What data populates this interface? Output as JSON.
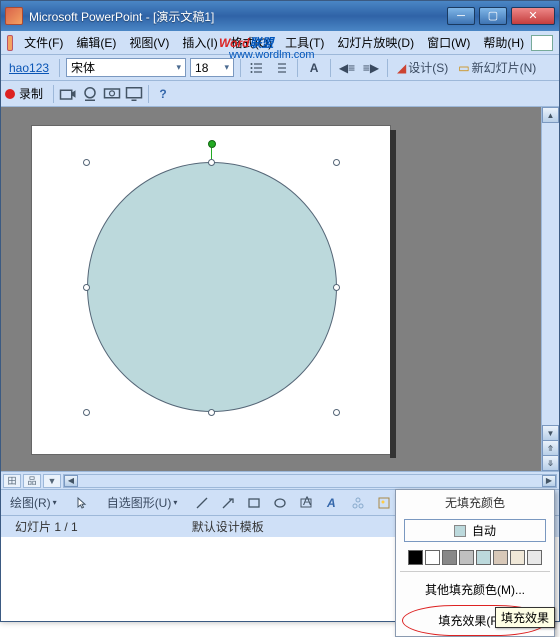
{
  "titlebar": {
    "title": "Microsoft PowerPoint - [演示文稿1]"
  },
  "menu": {
    "file": "文件(F)",
    "edit": "编辑(E)",
    "view": "视图(V)",
    "insert": "插入(I)",
    "format": "格式(O)",
    "tools": "工具(T)",
    "slideshow": "幻灯片放映(D)",
    "window": "窗口(W)",
    "help": "帮助(H)"
  },
  "toolbar1": {
    "hao": "hao123",
    "font": "宋体",
    "size": "18",
    "design": "设计(S)",
    "newslide": "新幻灯片(N)"
  },
  "toolbar2": {
    "rec": "录制"
  },
  "drawbar": {
    "draw": "绘图(R)",
    "autoshape": "自选图形(U)"
  },
  "status": {
    "slide": "幻灯片 1 / 1",
    "template": "默认设计模板"
  },
  "fill": {
    "nofill": "无填充颜色",
    "auto": "自动",
    "more": "其他填充颜色(M)...",
    "effects": "填充效果(F)..."
  },
  "swatches": [
    "#000000",
    "#ffffff",
    "#888888",
    "#c0c0c0",
    "#bcd9dc",
    "#d8c8b8",
    "#f0e8d8",
    "#e8e8e8"
  ],
  "tooltip": "填充效果",
  "watermark": {
    "part1": "Word",
    "part2": "联盟",
    "url": "www.wordlm.com"
  }
}
